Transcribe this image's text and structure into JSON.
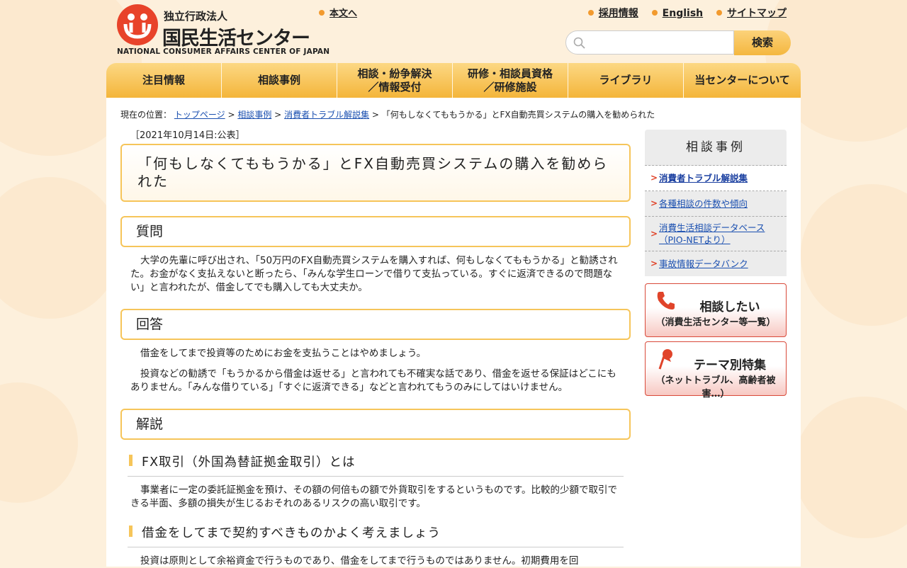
{
  "colors": {
    "accent": "#f4b53a",
    "brand_red": "#e8432a",
    "link": "#1a4fb0",
    "background": "#fdf0dc"
  },
  "header": {
    "logo_sub": "独立行政法人",
    "logo_main": "国民生活センター",
    "logo_en": "NATIONAL CONSUMER AFFAIRS CENTER OF JAPAN",
    "skip_link": "本文へ",
    "util_links": [
      "採用情報",
      "English",
      "サイトマップ"
    ],
    "search": {
      "placeholder": "",
      "button": "検索",
      "icon": "search-icon"
    }
  },
  "nav": [
    "注目情報",
    "相談事例",
    "相談・紛争解決\n／情報受付",
    "研修・相談員資格\n／研修施設",
    "ライブラリ",
    "当センターについて"
  ],
  "breadcrumb": {
    "prefix": "現在の位置：",
    "links": [
      "トップページ",
      "相談事例",
      "消費者トラブル解説集"
    ],
    "current": "「何もしなくてももうかる」とFX自動売買システムの購入を勧められた",
    "separator": ">"
  },
  "article": {
    "date": "［2021年10月14日:公表］",
    "title": "「何もしなくてももうかる」とFX自動売買システムの購入を勧められた",
    "question_heading": "質問",
    "question": "大学の先輩に呼び出され、「50万円のFX自動売買システムを購入すれば、何もしなくてももうかる」と勧誘された。お金がなく支払えないと断ったら、「みんな学生ローンで借りて支払っている。すぐに返済できるので問題ない」と言われたが、借金してでも購入しても大丈夫か。",
    "answer_heading": "回答",
    "answer_p1": "借金をしてまで投資等のためにお金を支払うことはやめましょう。",
    "answer_p2": "投資などの勧誘で「もうかるから借金は返せる」と言われても不確実な話であり、借金を返せる保証はどこにもありません。「みんな借りている」「すぐに返済できる」などと言われてもうのみにしてはいけません。",
    "commentary_heading": "解説",
    "sub1_heading": "FX取引（外国為替証拠金取引）とは",
    "sub1_text": "事業者に一定の委託証拠金を預け、その額の何倍もの額で外貨取引をするというものです。比較的少額で取引できる半面、多額の損失が生じるおそれのあるリスクの高い取引です。",
    "sub2_heading": "借金をしてまで契約すべきものかよく考えましょう",
    "sub2_text": "投資は原則として余裕資金で行うものであり、借金をしてまで行うものではありません。初期費用を回"
  },
  "sidebar": {
    "title": "相談事例",
    "items": [
      {
        "label": "消費者トラブル解説集",
        "current": true
      },
      {
        "label": "各種相談の件数や傾向",
        "current": false
      },
      {
        "label": "消費生活相談データベース（PIO-NETより）",
        "current": false
      },
      {
        "label": "事故情報データバンク",
        "current": false
      }
    ],
    "banners": [
      {
        "title": "相談したい",
        "sub": "（消費生活センター等一覧）",
        "icon": "phone-icon"
      },
      {
        "title": "テーマ別特集",
        "sub": "（ネットトラブル、高齢者被害…）",
        "icon": "pushpin-icon"
      }
    ]
  }
}
